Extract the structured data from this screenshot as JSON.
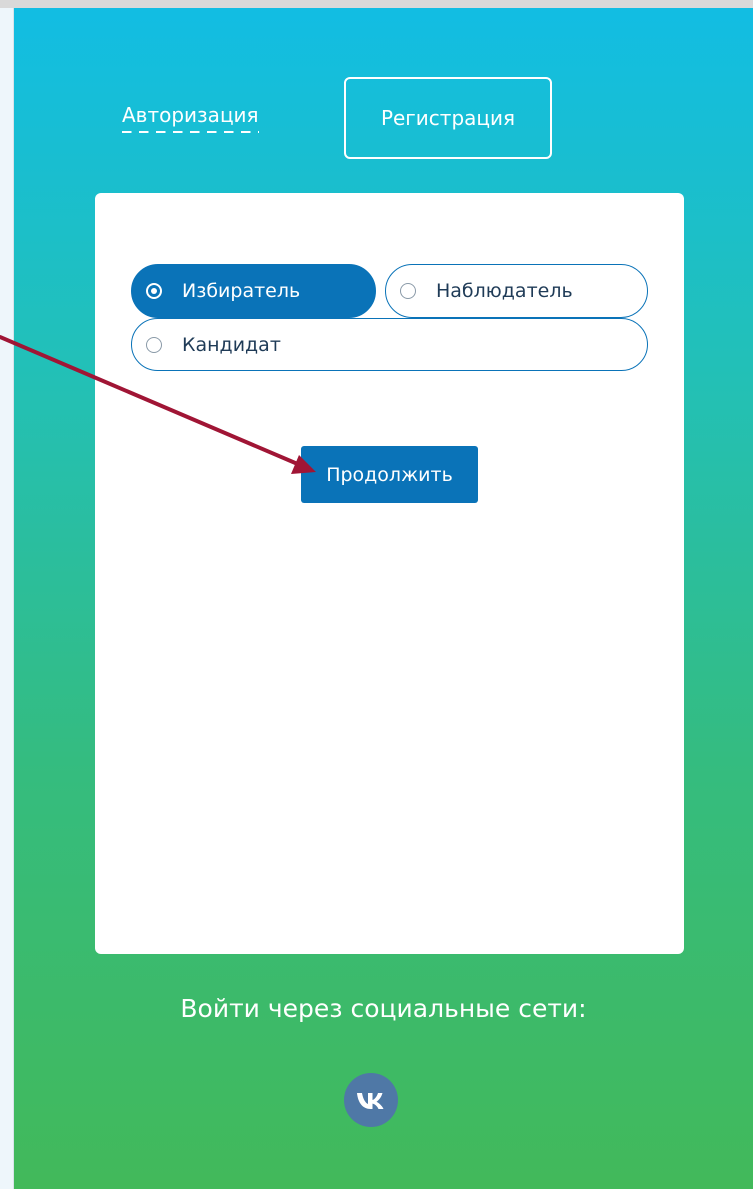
{
  "tabs": {
    "auth_label": "Авторизация",
    "register_label": "Регистрация"
  },
  "roles": {
    "selected": "voter",
    "voter_label": "Избиратель",
    "observer_label": "Наблюдатель",
    "candidate_label": "Кандидат"
  },
  "form": {
    "continue_label": "Продолжить"
  },
  "social": {
    "title": "Войти через социальные сети:",
    "vk_icon": "vk-logo-icon"
  },
  "colors": {
    "primary": "#0a73b8",
    "gradient_top": "#12bde3",
    "gradient_bottom": "#42b95a",
    "vk": "#4f78a6",
    "annotation_arrow": "#a01535"
  }
}
